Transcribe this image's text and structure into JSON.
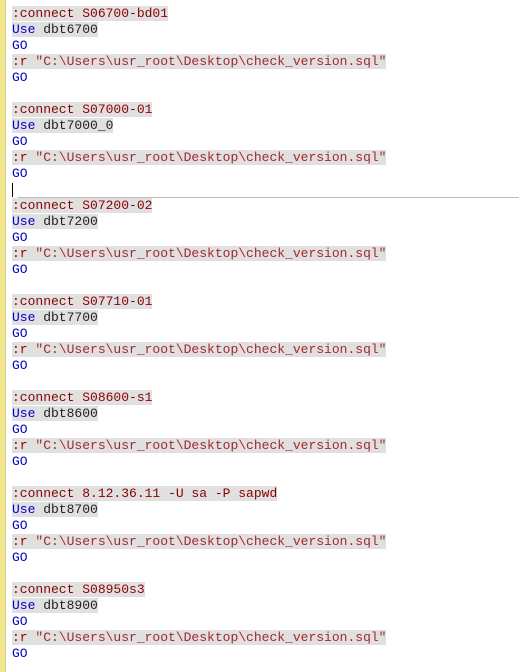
{
  "blocks": [
    {
      "connect": ":connect S06700-bd01",
      "use_kw": "Use",
      "use_db": " dbt6700",
      "go1": "GO",
      "r_kw": ":r",
      "r_path": " \"C:\\Users\\usr_root\\Desktop\\check_version.sql\"",
      "go2": "GO"
    },
    {
      "connect": ":connect S07000-01",
      "use_kw": "Use",
      "use_db": " dbt7000_0",
      "go1": "GO",
      "r_kw": ":r",
      "r_path": " \"C:\\Users\\usr_root\\Desktop\\check_version.sql\"",
      "go2": "GO"
    },
    {
      "connect": ":connect S07200-02",
      "use_kw": "Use",
      "use_db": " dbt7200",
      "go1": "GO",
      "r_kw": ":r",
      "r_path": " \"C:\\Users\\usr_root\\Desktop\\check_version.sql\"",
      "go2": "GO"
    },
    {
      "connect": ":connect S07710-01",
      "use_kw": "Use",
      "use_db": " dbt7700",
      "go1": "GO",
      "r_kw": ":r",
      "r_path": " \"C:\\Users\\usr_root\\Desktop\\check_version.sql\"",
      "go2": "GO"
    },
    {
      "connect": ":connect S08600-s1",
      "use_kw": "Use",
      "use_db": " dbt8600",
      "go1": "GO",
      "r_kw": ":r",
      "r_path": " \"C:\\Users\\usr_root\\Desktop\\check_version.sql\"",
      "go2": "GO"
    },
    {
      "connect": ":connect 8.12.36.11 -U sa -P sapwd",
      "use_kw": "Use",
      "use_db": " dbt8700",
      "go1": "GO",
      "r_kw": ":r",
      "r_path": " \"C:\\Users\\usr_root\\Desktop\\check_version.sql\"",
      "go2": "GO"
    },
    {
      "connect": ":connect S08950s3",
      "use_kw": "Use",
      "use_db": " dbt8900",
      "go1": "GO",
      "r_kw": ":r",
      "r_path": " \"C:\\Users\\usr_root\\Desktop\\check_version.sql\"",
      "go2": "GO"
    }
  ],
  "cursor_after_block_index": 1
}
